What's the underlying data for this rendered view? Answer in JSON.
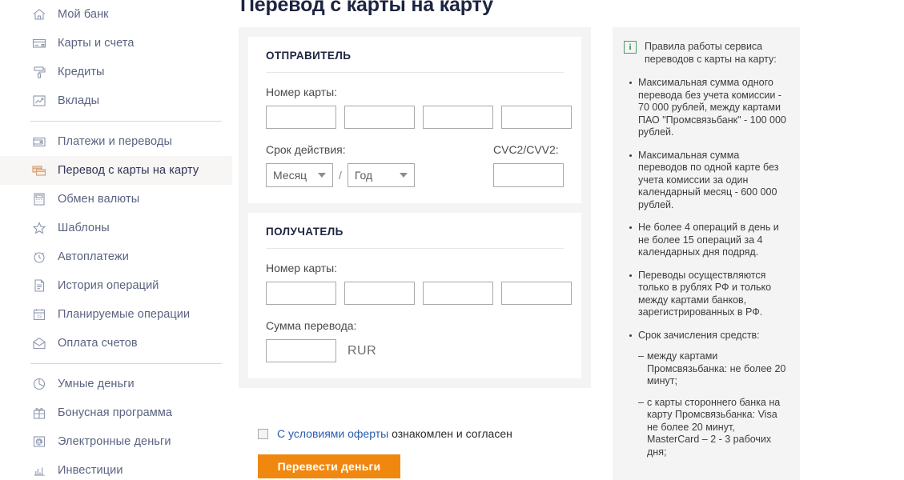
{
  "sidebar": {
    "groups": [
      {
        "items": [
          {
            "label": "Мой банк",
            "icon": "home-icon",
            "active": false
          },
          {
            "label": "Карты и счета",
            "icon": "card-icon",
            "active": false
          },
          {
            "label": "Кредиты",
            "icon": "paint-roller-icon",
            "active": false
          },
          {
            "label": "Вклады",
            "icon": "chart-line-icon",
            "active": false
          }
        ]
      },
      {
        "items": [
          {
            "label": "Платежи и переводы",
            "icon": "wallet-icon",
            "active": false
          },
          {
            "label": "Перевод с карты на карту",
            "icon": "card-transfer-icon",
            "active": true
          },
          {
            "label": "Обмен валюты",
            "icon": "calculator-icon",
            "active": false
          },
          {
            "label": "Шаблоны",
            "icon": "star-icon",
            "active": false
          },
          {
            "label": "Автоплатежи",
            "icon": "alarm-clock-icon",
            "active": false
          },
          {
            "label": "История операций",
            "icon": "document-icon",
            "active": false
          },
          {
            "label": "Планируемые операции",
            "icon": "calendar-icon",
            "active": false
          },
          {
            "label": "Оплата счетов",
            "icon": "envelope-icon",
            "active": false
          }
        ]
      },
      {
        "items": [
          {
            "label": "Умные деньги",
            "icon": "pie-chart-icon",
            "active": false
          },
          {
            "label": "Бонусная программа",
            "icon": "gift-icon",
            "active": false
          },
          {
            "label": "Электронные деньги",
            "icon": "at-sign-icon",
            "active": false
          },
          {
            "label": "Инвестиции",
            "icon": "bar-chart-icon",
            "active": false
          }
        ]
      }
    ]
  },
  "main": {
    "title": "Перевод с карты на карту",
    "sender": {
      "heading": "ОТПРАВИТЕЛЬ",
      "card_number_label": "Номер карты:",
      "card_number_values": [
        "",
        "",
        "",
        ""
      ],
      "expiry_label": "Срок действия:",
      "month_value": "Месяц",
      "year_value": "Год",
      "separator": "/",
      "cvc_label": "CVC2/CVV2:",
      "cvc_value": ""
    },
    "recipient": {
      "heading": "ПОЛУЧАТЕЛЬ",
      "card_number_label": "Номер карты:",
      "card_number_values": [
        "",
        "",
        "",
        ""
      ],
      "amount_label": "Сумма перевода:",
      "amount_value": "",
      "currency": "RUR"
    },
    "agreement": {
      "link_text": "С условиями оферты",
      "rest_text": " ознакомлен и согласен",
      "checked": false
    },
    "submit_label": "Перевести деньги"
  },
  "info": {
    "icon": "info-icon",
    "heading": "Правила работы сервиса переводов с карты на карту:",
    "bullets": [
      {
        "text": "Максимальная сумма одного перевода без учета комиссии - 70 000 рублей, между картами ПАО \"Промсвязьбанк\" - 100 000 рублей."
      },
      {
        "text": "Максимальная сумма переводов по одной карте без учета комиссии за один календарный месяц - 600 000 рублей."
      },
      {
        "text": "Не более 4 операций в день и не более 15 операций за 4 календарных дня подряд."
      },
      {
        "text": "Переводы осуществляются только в рублях РФ и только между картами банков, зарегистрированных в РФ."
      },
      {
        "text": "Срок зачисления средств:",
        "sub": [
          "между картами Промсвязьбанка: не более 20 минут;",
          "с карты стороннего банка на карту Промсвязьбанка: Visa не более 20 минут, MasterCard – 2 - 3 рабочих дня;"
        ]
      }
    ]
  },
  "colors": {
    "accent_orange": "#f0880f",
    "link_blue": "#2a5db0",
    "nav_text": "#5a6480",
    "info_green": "#4e9a60"
  }
}
